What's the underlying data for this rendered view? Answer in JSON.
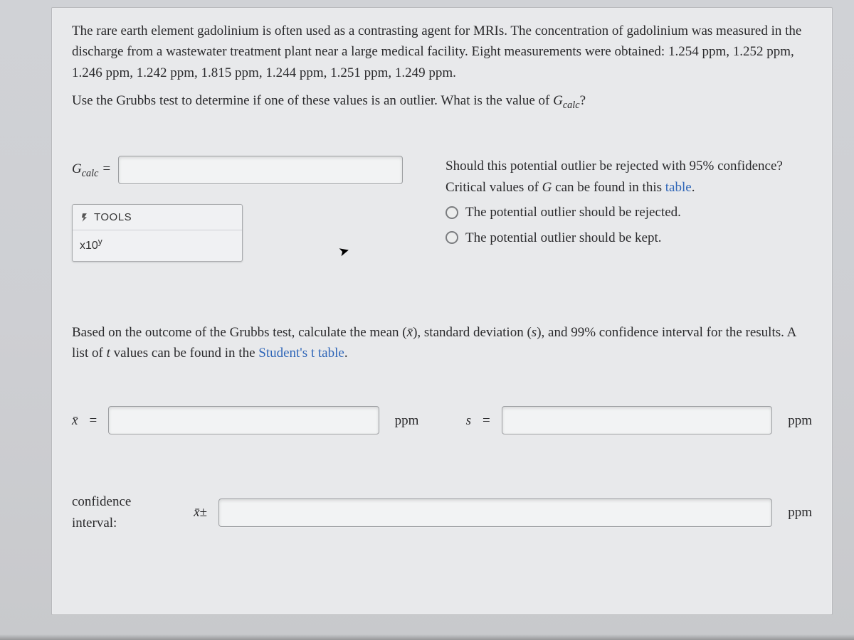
{
  "question": {
    "para1_a": "The rare earth element gadolinium is often used as a contrasting agent for MRIs. The concentration of gadolinium was measured in the discharge from a wastewater treatment plant near a large medical facility. Eight measurements were obtained: 1.254 ppm, 1.252 ppm, 1.246 ppm, 1.242 ppm, 1.815 ppm, 1.244 ppm, 1.251 ppm, 1.249 ppm.",
    "para1_b_pre": "Use the Grubbs test to determine if one of these values is an outlier. What is the value of ",
    "para1_b_gvar": "G",
    "para1_b_gsub": "calc",
    "para1_b_post": "?"
  },
  "gcalc": {
    "g_letter": "G",
    "g_sub": "calc",
    "equals": " = "
  },
  "tools": {
    "header": "TOOLS",
    "sci_btn_base": "x10",
    "sci_btn_exp": "y"
  },
  "right": {
    "line1": "Should this potential outlier be rejected with 95% confidence? Critical values of ",
    "gletter": "G",
    "line1b": " can be found in this ",
    "table_link": "table",
    "period": ".",
    "opt_reject": "The potential outlier should be rejected.",
    "opt_keep": "The potential outlier should be kept."
  },
  "para2": {
    "text_a": "Based on the outcome of the Grubbs test, calculate the mean (",
    "xbar_char": "x̄",
    "text_b": "), standard deviation (",
    "s_char": "s",
    "text_c": "), and 99% confidence interval for the results. A list of ",
    "t_char": "t",
    "text_d": " values can be found in the ",
    "t_link": "Student's t table",
    "text_e": "."
  },
  "labels": {
    "xbar": "x̄",
    "equals": " = ",
    "ppm": "ppm",
    "s": "s",
    "ci_label": "confidence interval:",
    "ci_expr": "x̄±"
  }
}
